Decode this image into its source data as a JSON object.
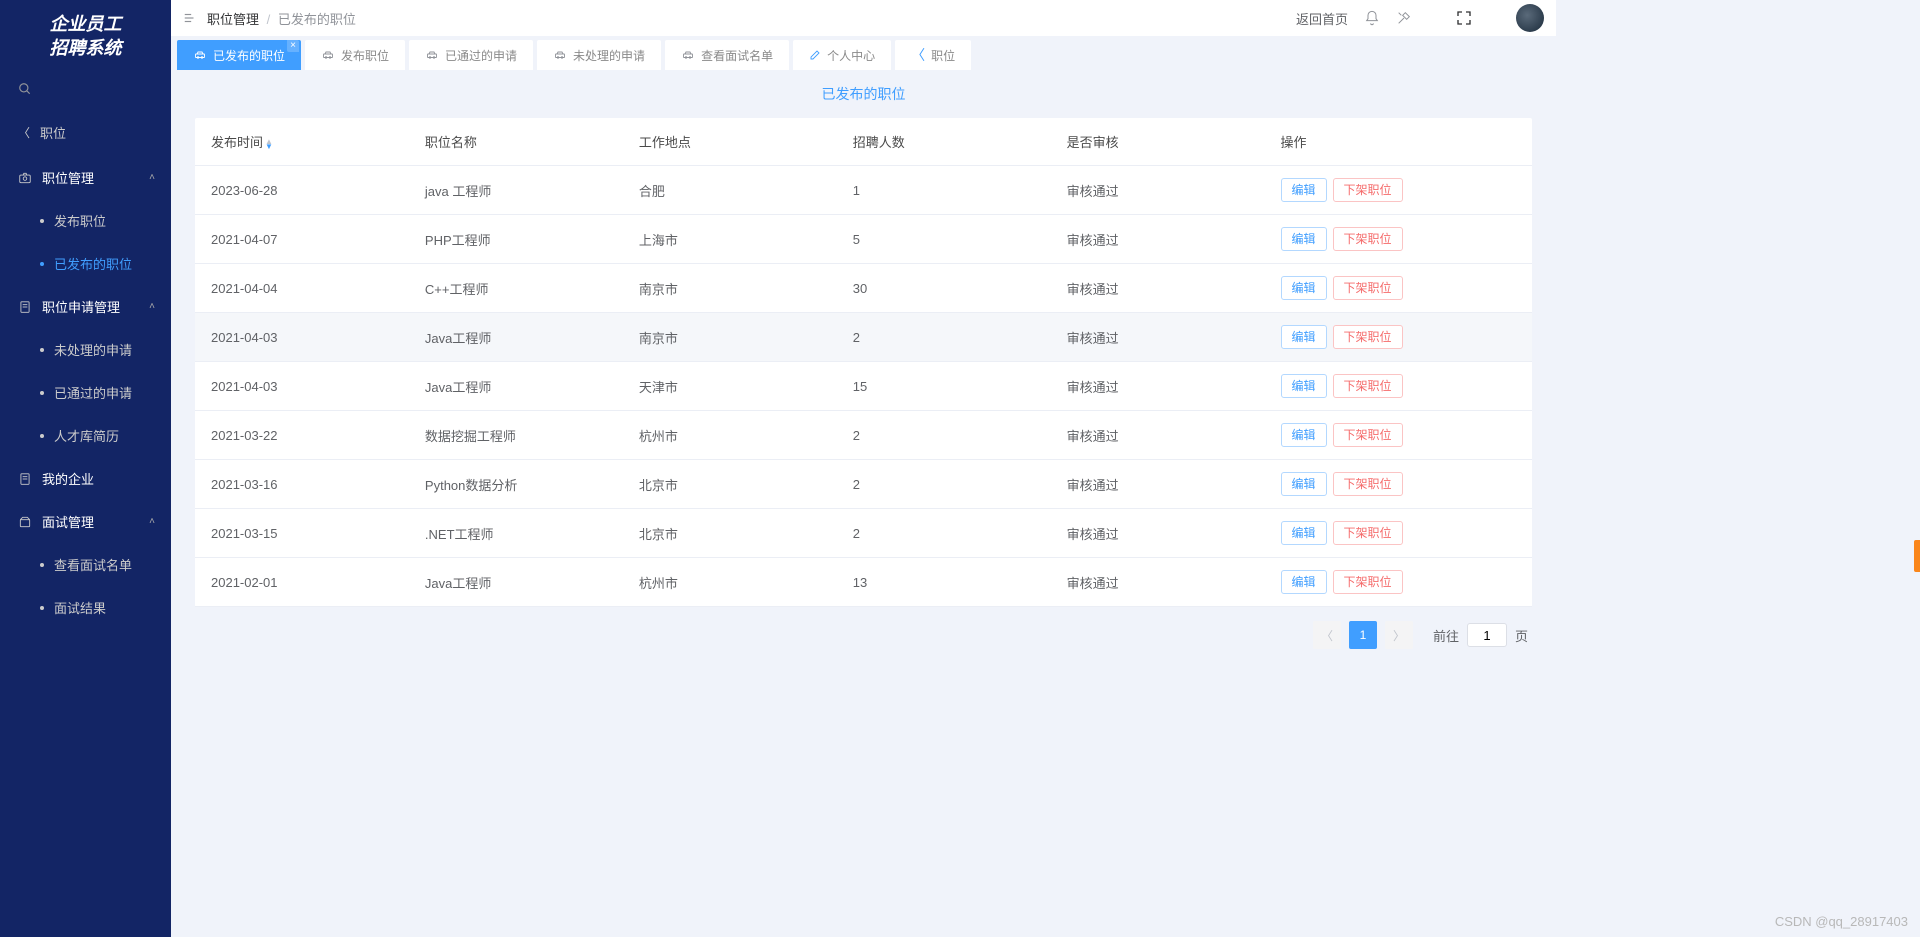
{
  "app_title_l1": "企业员工",
  "app_title_l2": "招聘系统",
  "sidebar": {
    "back_label": "职位",
    "groups": [
      {
        "label": "职位管理",
        "expanded": true,
        "items": [
          {
            "label": "发布职位",
            "active": false
          },
          {
            "label": "已发布的职位",
            "active": true
          }
        ]
      },
      {
        "label": "职位申请管理",
        "expanded": true,
        "items": [
          {
            "label": "未处理的申请",
            "active": false
          },
          {
            "label": "已通过的申请",
            "active": false
          },
          {
            "label": "人才库简历",
            "active": false
          }
        ]
      },
      {
        "label": "我的企业",
        "expanded": false,
        "items": []
      },
      {
        "label": "面试管理",
        "expanded": true,
        "items": [
          {
            "label": "查看面试名单",
            "active": false
          },
          {
            "label": "面试结果",
            "active": false
          }
        ]
      }
    ]
  },
  "breadcrumb": {
    "l1": "职位管理",
    "l2": "已发布的职位"
  },
  "topbar": {
    "home": "返回首页"
  },
  "tabs": [
    {
      "label": "已发布的职位",
      "icon": "car",
      "active": true,
      "closable": true
    },
    {
      "label": "发布职位",
      "icon": "car",
      "active": false
    },
    {
      "label": "已通过的申请",
      "icon": "car",
      "active": false
    },
    {
      "label": "未处理的申请",
      "icon": "car",
      "active": false
    },
    {
      "label": "查看面试名单",
      "icon": "car",
      "active": false
    },
    {
      "label": "个人中心",
      "icon": "edit",
      "active": false
    },
    {
      "label": "职位",
      "icon": "back",
      "active": false
    }
  ],
  "page": {
    "title": "已发布的职位",
    "columns": [
      "发布时间",
      "职位名称",
      "工作地点",
      "招聘人数",
      "是否审核",
      "操作"
    ],
    "actions": {
      "edit": "编辑",
      "remove": "下架职位"
    },
    "rows": [
      {
        "date": "2023-06-28",
        "name": "java 工程师",
        "loc": "合肥",
        "count": "1",
        "audit": "审核通过"
      },
      {
        "date": "2021-04-07",
        "name": "PHP工程师",
        "loc": "上海市",
        "count": "5",
        "audit": "审核通过"
      },
      {
        "date": "2021-04-04",
        "name": "C++工程师",
        "loc": "南京市",
        "count": "30",
        "audit": "审核通过"
      },
      {
        "date": "2021-04-03",
        "name": "Java工程师",
        "loc": "南京市",
        "count": "2",
        "audit": "审核通过",
        "hover": true
      },
      {
        "date": "2021-04-03",
        "name": "Java工程师",
        "loc": "天津市",
        "count": "15",
        "audit": "审核通过"
      },
      {
        "date": "2021-03-22",
        "name": "数据挖掘工程师",
        "loc": "杭州市",
        "count": "2",
        "audit": "审核通过"
      },
      {
        "date": "2021-03-16",
        "name": "Python数据分析",
        "loc": "北京市",
        "count": "2",
        "audit": "审核通过"
      },
      {
        "date": "2021-03-15",
        "name": ".NET工程师",
        "loc": "北京市",
        "count": "2",
        "audit": "审核通过"
      },
      {
        "date": "2021-02-01",
        "name": "Java工程师",
        "loc": "杭州市",
        "count": "13",
        "audit": "审核通过"
      }
    ]
  },
  "pagination": {
    "goto_prefix": "前往",
    "goto_suffix": "页",
    "current": "1",
    "input": "1"
  },
  "watermark": "CSDN @qq_28917403"
}
